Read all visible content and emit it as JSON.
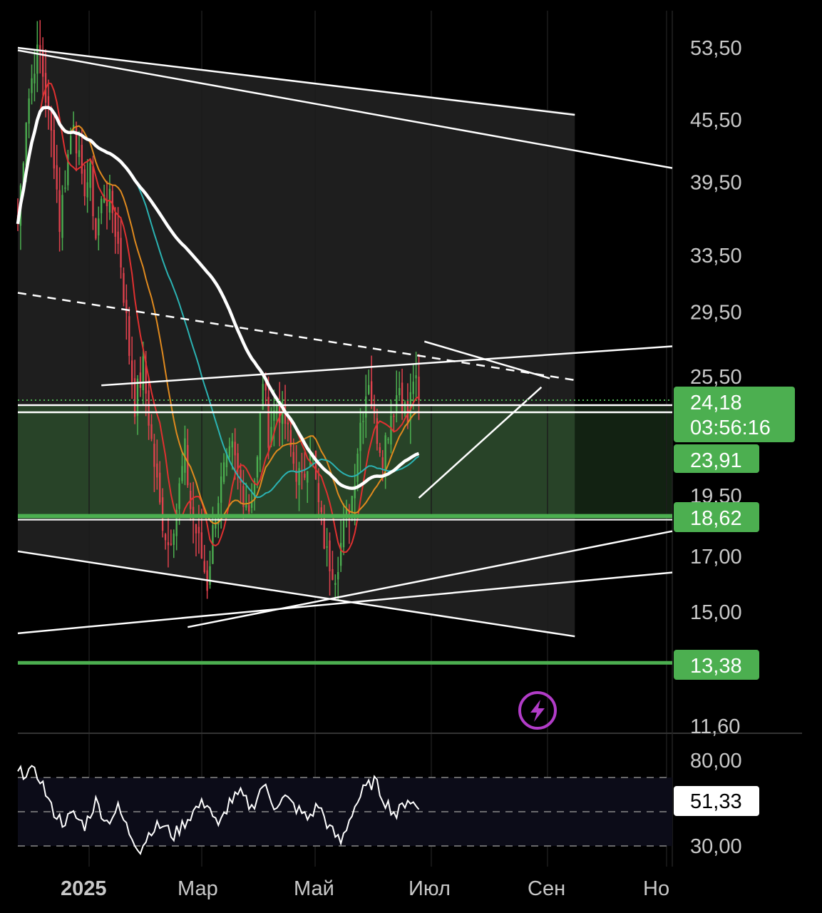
{
  "chart_data": [
    {
      "type": "candlestick",
      "panel": "price",
      "y_ticks": [
        "53,50",
        "45,50",
        "39,50",
        "33,50",
        "29,50",
        "25,50",
        "19,50",
        "17,00",
        "15,00",
        "11,60"
      ],
      "y_tick_values": [
        53.5,
        45.5,
        39.5,
        33.5,
        29.5,
        25.5,
        19.5,
        17.0,
        15.0,
        11.6
      ],
      "x_ticks": [
        "2025",
        "Мар",
        "Май",
        "Июл",
        "Сен",
        "Но"
      ],
      "scale": "log",
      "current_price": {
        "value": "24,18",
        "countdown": "03:56:16",
        "color": "#4caf50"
      },
      "levels": [
        {
          "label": "23,91",
          "value": 23.91,
          "color": "#4caf50"
        },
        {
          "label": "18,62",
          "value": 18.62,
          "color": "#4caf50"
        },
        {
          "label": "13,38",
          "value": 13.38,
          "color": "#4caf50"
        }
      ],
      "close_series": [
        {
          "x": 0,
          "y": 36.0
        },
        {
          "x": 3,
          "y": 46.0
        },
        {
          "x": 6,
          "y": 52.0
        },
        {
          "x": 8,
          "y": 53.0
        },
        {
          "x": 10,
          "y": 48.0
        },
        {
          "x": 13,
          "y": 42.0
        },
        {
          "x": 15,
          "y": 36.0
        },
        {
          "x": 17,
          "y": 40.0
        },
        {
          "x": 20,
          "y": 46.0
        },
        {
          "x": 23,
          "y": 39.0
        },
        {
          "x": 26,
          "y": 40.0
        },
        {
          "x": 28,
          "y": 35.0
        },
        {
          "x": 31,
          "y": 39.0
        },
        {
          "x": 34,
          "y": 37.0
        },
        {
          "x": 37,
          "y": 33.0
        },
        {
          "x": 40,
          "y": 27.0
        },
        {
          "x": 42,
          "y": 24.0
        },
        {
          "x": 45,
          "y": 26.0
        },
        {
          "x": 48,
          "y": 22.0
        },
        {
          "x": 51,
          "y": 19.0
        },
        {
          "x": 54,
          "y": 17.5
        },
        {
          "x": 57,
          "y": 19.0
        },
        {
          "x": 60,
          "y": 21.5
        },
        {
          "x": 62,
          "y": 19.0
        },
        {
          "x": 65,
          "y": 17.5
        },
        {
          "x": 68,
          "y": 16.0
        },
        {
          "x": 71,
          "y": 19.0
        },
        {
          "x": 74,
          "y": 20.5
        },
        {
          "x": 77,
          "y": 21.5
        },
        {
          "x": 80,
          "y": 20.0
        },
        {
          "x": 83,
          "y": 19.0
        },
        {
          "x": 86,
          "y": 21.0
        },
        {
          "x": 88,
          "y": 25.5
        },
        {
          "x": 90,
          "y": 22.5
        },
        {
          "x": 93,
          "y": 24.0
        },
        {
          "x": 96,
          "y": 23.0
        },
        {
          "x": 99,
          "y": 21.0
        },
        {
          "x": 102,
          "y": 20.0
        },
        {
          "x": 105,
          "y": 22.0
        },
        {
          "x": 108,
          "y": 19.0
        },
        {
          "x": 111,
          "y": 17.0
        },
        {
          "x": 114,
          "y": 16.5
        },
        {
          "x": 117,
          "y": 18.0
        },
        {
          "x": 120,
          "y": 19.5
        },
        {
          "x": 123,
          "y": 23.0
        },
        {
          "x": 126,
          "y": 25.5
        },
        {
          "x": 128,
          "y": 23.0
        },
        {
          "x": 131,
          "y": 21.5
        },
        {
          "x": 134,
          "y": 23.5
        },
        {
          "x": 137,
          "y": 25.0
        },
        {
          "x": 140,
          "y": 23.0
        },
        {
          "x": 142,
          "y": 25.5
        },
        {
          "x": 144,
          "y": 24.18
        }
      ]
    },
    {
      "type": "line",
      "panel": "rsi",
      "y_ticks": [
        "80,00",
        "30,00"
      ],
      "y_tick_values": [
        80,
        30
      ],
      "bands": [
        70,
        50,
        30
      ],
      "current": "51,33",
      "values": [
        {
          "x": 0,
          "y": 72
        },
        {
          "x": 4,
          "y": 74
        },
        {
          "x": 8,
          "y": 70
        },
        {
          "x": 12,
          "y": 52
        },
        {
          "x": 16,
          "y": 44
        },
        {
          "x": 20,
          "y": 48
        },
        {
          "x": 24,
          "y": 42
        },
        {
          "x": 28,
          "y": 56
        },
        {
          "x": 32,
          "y": 44
        },
        {
          "x": 36,
          "y": 52
        },
        {
          "x": 40,
          "y": 38
        },
        {
          "x": 44,
          "y": 28
        },
        {
          "x": 48,
          "y": 40
        },
        {
          "x": 52,
          "y": 42
        },
        {
          "x": 56,
          "y": 36
        },
        {
          "x": 60,
          "y": 44
        },
        {
          "x": 64,
          "y": 52
        },
        {
          "x": 68,
          "y": 56
        },
        {
          "x": 72,
          "y": 40
        },
        {
          "x": 76,
          "y": 56
        },
        {
          "x": 80,
          "y": 60
        },
        {
          "x": 84,
          "y": 52
        },
        {
          "x": 88,
          "y": 66
        },
        {
          "x": 92,
          "y": 54
        },
        {
          "x": 96,
          "y": 58
        },
        {
          "x": 100,
          "y": 52
        },
        {
          "x": 104,
          "y": 46
        },
        {
          "x": 108,
          "y": 54
        },
        {
          "x": 112,
          "y": 40
        },
        {
          "x": 116,
          "y": 32
        },
        {
          "x": 120,
          "y": 50
        },
        {
          "x": 124,
          "y": 62
        },
        {
          "x": 128,
          "y": 68
        },
        {
          "x": 132,
          "y": 56
        },
        {
          "x": 136,
          "y": 48
        },
        {
          "x": 140,
          "y": 58
        },
        {
          "x": 144,
          "y": 51.33
        }
      ]
    }
  ],
  "colors": {
    "up": "#4caf50",
    "down": "#e0414d",
    "ma_fast": "#e03030",
    "ma_mid": "#e08a1e",
    "ma_slow": "#2bb3b3",
    "ma_long": "#ffffff",
    "zone": "#2a4a2a",
    "badge": "#4caf50",
    "flash_icon": "#b23cc8"
  },
  "icon": "lightning-icon"
}
